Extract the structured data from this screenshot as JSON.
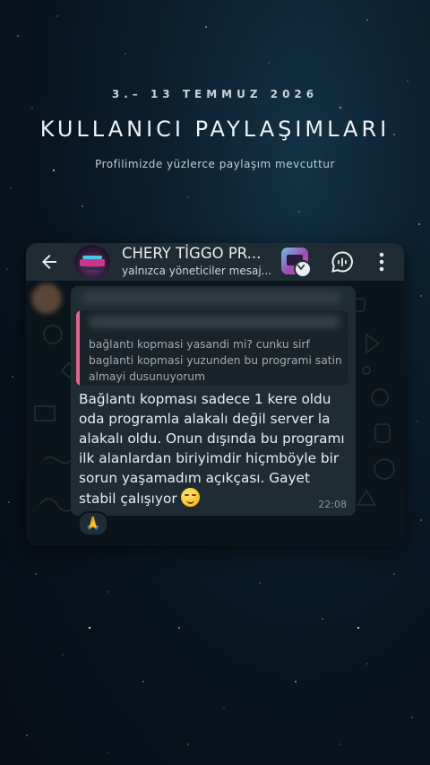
{
  "promo": {
    "dates": "3.– 13 TEMMUZ 2026",
    "title": "KULLANICI PAYLAŞIMLARI",
    "subtitle": "Profilimizde yüzlerce paylaşım mevcuttur"
  },
  "header": {
    "chat_name": "CHERY TİGGO PR...",
    "status": "yalnızca yöneticiler mesaj..."
  },
  "message": {
    "quoted_text": "bağlantı kopmasi yasandi mi? cunku sirf baglanti kopmasi yuzunden bu programi satin almayi dusunuyorum",
    "body": "Bağlantı kopması sadece 1 kere oldu oda programla alakalı değil server la alakalı oldu. Onun dışında bu programı ilk alanlardan biriyimdir hiçmböyle bir sorun yaşamadım açıkçası. Gayet stabil çalışıyor",
    "time": "22:08",
    "reaction": "🙏"
  },
  "icons": {
    "back": "arrow-left-icon",
    "voice_chat": "voice-chat-icon",
    "menu": "more-vertical-icon",
    "smile": "smiling-face-emoji-icon",
    "pray": "folded-hands-emoji-icon"
  },
  "colors": {
    "header_bg": "#1f2c34",
    "bubble_bg": "#1f2c34",
    "quote_bar": "#e0658e",
    "chat_bg": "#0b141a"
  }
}
